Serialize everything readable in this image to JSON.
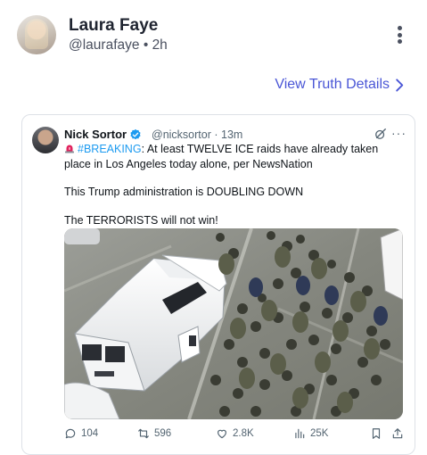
{
  "post": {
    "display_name": "Laura Faye",
    "handle": "@laurafaye",
    "separator": "•",
    "time": "2h",
    "view_details": "View Truth Details"
  },
  "embed": {
    "author_name": "Nick Sortor",
    "author_handle": "@nicksortor",
    "separator": "·",
    "time": "13m",
    "hashtag": "#BREAKING",
    "line1_rest": ": At least TWELVE ICE raids have already taken place in Los Angeles today alone, per NewsNation",
    "line2": "This Trump administration is DOUBLING DOWN",
    "line3": "The TERRORISTS will not win!",
    "more": "···",
    "actions": {
      "replies": "104",
      "reposts": "596",
      "likes": "2.8K",
      "views": "25K"
    }
  },
  "colors": {
    "link": "#4a56d6",
    "hashtag": "#1d9bf0",
    "verified": "#1d9bf0",
    "siren": "#e0245e"
  },
  "icons": [
    "more-vertical-icon",
    "chevron-right-icon",
    "verified-badge-icon",
    "grok-icon",
    "siren-icon",
    "reply-icon",
    "repost-icon",
    "like-icon",
    "views-icon",
    "bookmark-icon",
    "share-icon"
  ]
}
